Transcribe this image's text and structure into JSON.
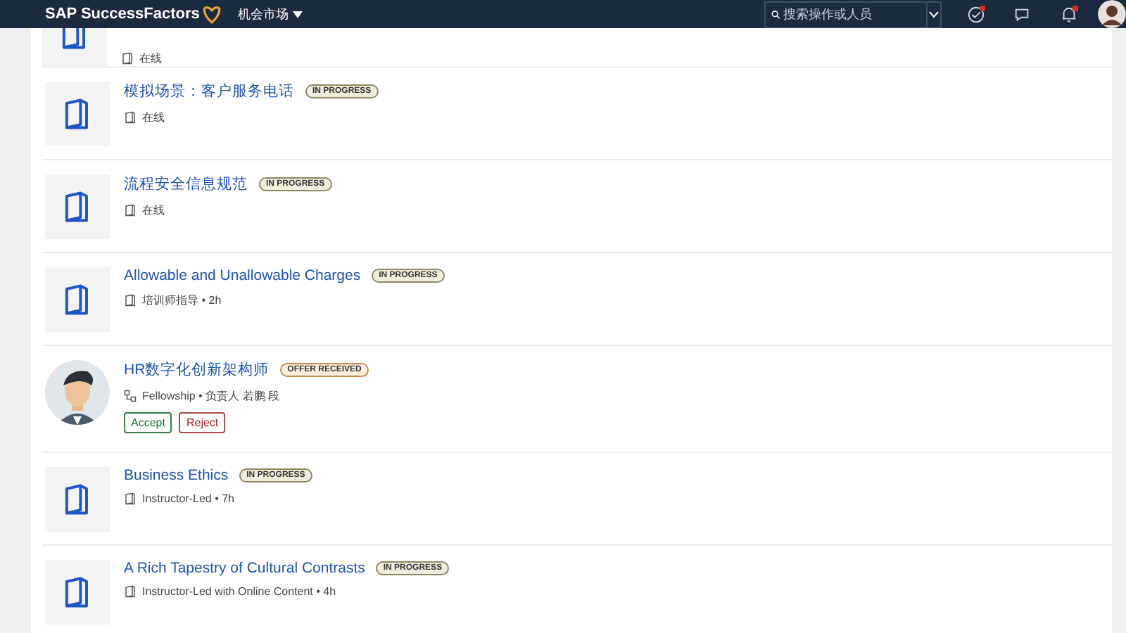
{
  "header": {
    "logo": "SAP SuccessFactors",
    "menu": "机会市场",
    "search": {
      "placeholder": "搜索操作或人员"
    }
  },
  "items": [
    {
      "kind": "course",
      "meta": "在线"
    },
    {
      "kind": "course",
      "title": "模拟场景：客户服务电话",
      "badge": {
        "text": "IN PROGRESS",
        "kind": "progress"
      },
      "meta": "在线"
    },
    {
      "kind": "course",
      "title": "流程安全信息规范",
      "badge": {
        "text": "IN PROGRESS",
        "kind": "progress"
      },
      "meta": "在线"
    },
    {
      "kind": "course",
      "title": "Allowable and Unallowable Charges",
      "badge": {
        "text": "IN PROGRESS",
        "kind": "progress"
      },
      "meta": "培训师指导 • 2h"
    },
    {
      "kind": "opportunity",
      "title": "HR数字化创新架构师",
      "badge": {
        "text": "OFFER RECEIVED",
        "kind": "offer"
      },
      "meta": "Fellowship • 负责人 若鹏 段",
      "buttons": [
        {
          "label": "Accept",
          "kind": "accept"
        },
        {
          "label": "Reject",
          "kind": "reject"
        }
      ]
    },
    {
      "kind": "course",
      "title": "Business Ethics",
      "badge": {
        "text": "IN PROGRESS",
        "kind": "progress"
      },
      "meta": "Instructor-Led • 7h"
    },
    {
      "kind": "course",
      "title": "A Rich Tapestry of Cultural Contrasts",
      "badge": {
        "text": "IN PROGRESS",
        "kind": "progress"
      },
      "meta": "Instructor-Led with Online Content • 4h"
    }
  ]
}
